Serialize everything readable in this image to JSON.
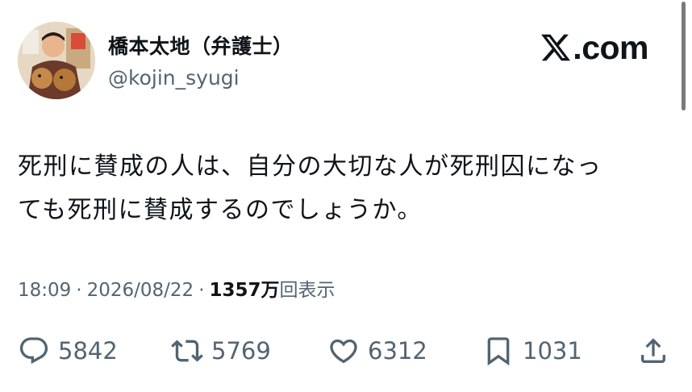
{
  "author": {
    "name": "橋本太地（弁護士）",
    "handle": "@kojin_syugi"
  },
  "brand": {
    "label": ".com",
    "icon": "x-logo-icon"
  },
  "tweet": {
    "lines": [
      "死刑に賛成の人は、自分の大切な人が死刑囚になっ",
      "ても死刑に賛成するのでしょうか。"
    ]
  },
  "meta": {
    "time": "18:09",
    "separator": "·",
    "date": "2026/08/22",
    "views_count": "1357万",
    "views_label": "回表示"
  },
  "actions": {
    "reply": {
      "icon": "reply-icon",
      "count": "5842"
    },
    "repost": {
      "icon": "repost-icon",
      "count": "5769"
    },
    "like": {
      "icon": "heart-icon",
      "count": "6312"
    },
    "bookmark": {
      "icon": "bookmark-icon",
      "count": "1031"
    },
    "share": {
      "icon": "share-icon"
    }
  },
  "colors": {
    "text": "#0f1419",
    "muted": "#536471",
    "background": "#ffffff"
  }
}
